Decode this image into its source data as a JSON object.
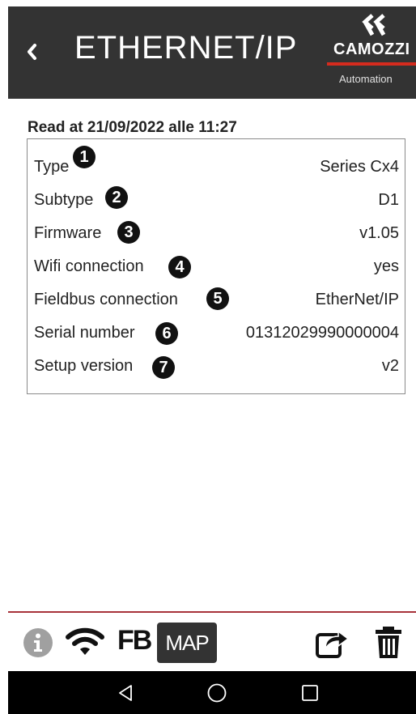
{
  "header": {
    "title": "ETHERNET/IP",
    "back_icon": "chevron-left-icon",
    "logo": {
      "brand": "CAMOZZI",
      "subtitle": "Automation",
      "accent_color": "#d52b1e"
    }
  },
  "read_at": "Read at 21/09/2022 alle 11:27",
  "info": [
    {
      "label": "Type",
      "value": "Series Cx4",
      "badge": "1"
    },
    {
      "label": "Subtype",
      "value": "D1",
      "badge": "2"
    },
    {
      "label": "Firmware",
      "value": "v1.05",
      "badge": "3"
    },
    {
      "label": "Wifi connection",
      "value": "yes",
      "badge": "4"
    },
    {
      "label": "Fieldbus connection",
      "value": "EtherNet/IP",
      "badge": "5"
    },
    {
      "label": "Serial number",
      "value": "01312029990000004",
      "badge": "6"
    },
    {
      "label": "Setup version",
      "value": "v2",
      "badge": "7"
    }
  ],
  "toolbar": {
    "info_icon": "info-icon",
    "wifi_icon": "wifi-icon",
    "fb_label": "FB",
    "map_label": "MAP",
    "share_icon": "share-icon",
    "trash_icon": "trash-icon",
    "line_color": "#a8323a"
  },
  "navbar": {
    "back_icon": "triangle-back-icon",
    "home_icon": "circle-home-icon",
    "recents_icon": "square-recents-icon"
  }
}
